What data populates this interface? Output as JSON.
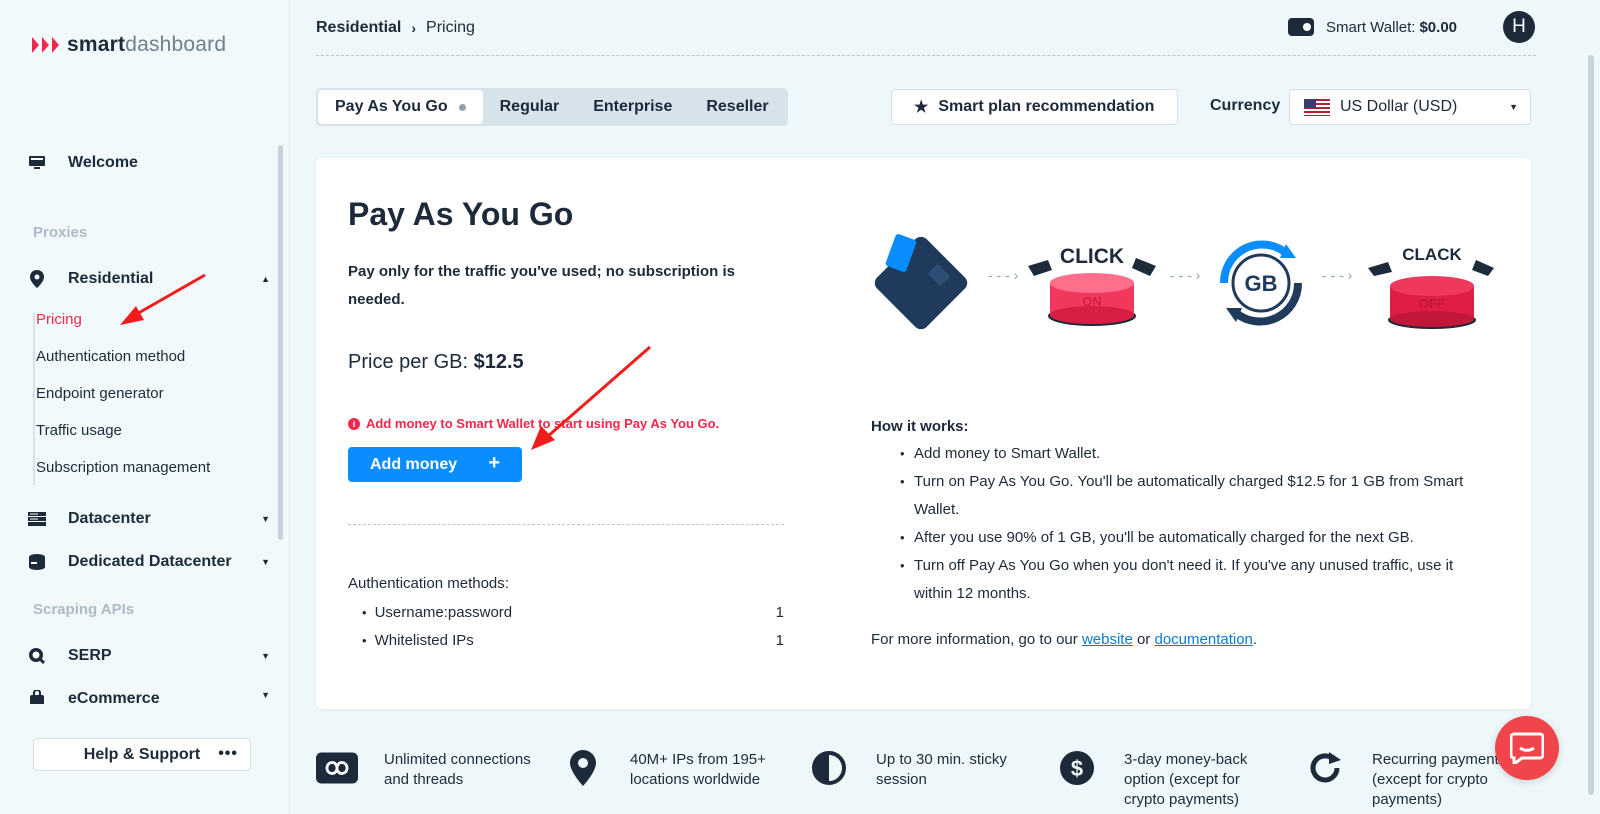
{
  "brand": {
    "name_bold": "smart",
    "name_light": "dashboard"
  },
  "sidebar": {
    "welcome": "Welcome",
    "section_proxies": "Proxies",
    "residential": "Residential",
    "subitems": [
      "Pricing",
      "Authentication method",
      "Endpoint generator",
      "Traffic usage",
      "Subscription management"
    ],
    "datacenter": "Datacenter",
    "dedicated_datacenter": "Dedicated Datacenter",
    "section_scraping": "Scraping APIs",
    "serp": "SERP",
    "ecommerce": "eCommerce",
    "help": "Help & Support"
  },
  "header": {
    "breadcrumb": [
      "Residential",
      "Pricing"
    ],
    "wallet_label": "Smart Wallet:",
    "wallet_value": "$0.00",
    "avatar_initial": "H"
  },
  "plans": {
    "tabs": [
      "Pay As You Go",
      "Regular",
      "Enterprise",
      "Reseller"
    ],
    "active_tab": "Pay As You Go",
    "recommendation_button": "Smart plan recommendation",
    "currency_label": "Currency",
    "currency_value": "US Dollar (USD)"
  },
  "card": {
    "title": "Pay As You Go",
    "description": "Pay only for the traffic you've used; no subscription is needed.",
    "price_label": "Price per GB:",
    "price_value": "$12.5",
    "warning": "Add money to Smart Wallet to start using Pay As You Go.",
    "add_money_button": "Add money",
    "auth_title": "Authentication methods:",
    "auth_methods": [
      {
        "name": "Username:password",
        "count": "1"
      },
      {
        "name": "Whitelisted IPs",
        "count": "1"
      }
    ],
    "illustration": {
      "click_text": "CLICK",
      "on_text": "ON",
      "gb_text": "GB",
      "clack_text": "CLACK",
      "off_text": "OFF"
    },
    "how_title": "How it works:",
    "how_steps": [
      "Add money to Smart Wallet.",
      "Turn on Pay As You Go. You'll be automatically charged $12.5 for 1 GB from Smart Wallet.",
      "After you use 90% of 1 GB, you'll be automatically charged for the next GB.",
      "Turn off Pay As You Go when you don't need it. If you've any unused traffic, use it within 12 months."
    ],
    "more_info_prefix": "For more information, go to our",
    "more_info_link1": "website",
    "more_info_or": "or",
    "more_info_link2": "documentation",
    "more_info_suffix": "."
  },
  "features": [
    {
      "icon": "infinity-icon",
      "text": "Unlimited connections and threads"
    },
    {
      "icon": "location-pin-icon",
      "text": "40M+ IPs from 195+ locations worldwide"
    },
    {
      "icon": "half-circle-icon",
      "text": "Up to 30 min. sticky session"
    },
    {
      "icon": "dollar-icon",
      "text": "3-day money-back option (except for crypto payments)"
    },
    {
      "icon": "refresh-icon",
      "text": "Recurring payments (except for crypto payments)"
    }
  ],
  "colors": {
    "accent_red": "#f0284b",
    "primary_blue": "#0a8dff",
    "dark": "#1c2a3a"
  }
}
